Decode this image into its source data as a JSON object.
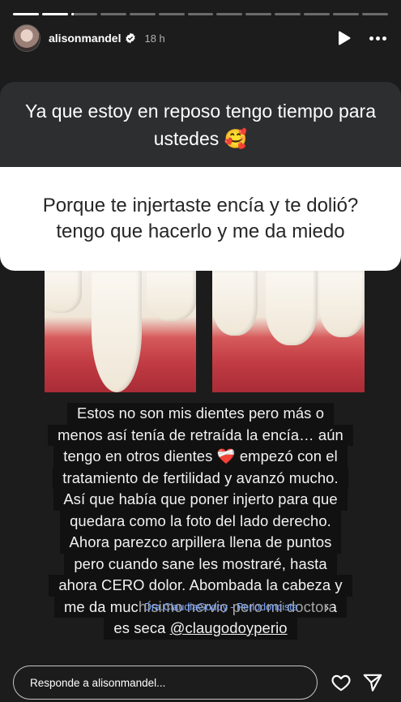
{
  "story": {
    "segments": [
      1,
      1,
      0.1,
      0,
      0,
      0,
      0,
      0,
      0,
      0,
      0,
      0,
      0
    ],
    "username": "alisonmandel",
    "verified": true,
    "time_ago": "18 h"
  },
  "question_box": {
    "prompt": "Ya que estoy en reposo tengo tiempo para ustedes 🥰",
    "question": "Porque te injertaste encía y te dolió? tengo que hacerlo y me da miedo"
  },
  "caption": {
    "lines": [
      "Estos no son mis dientes pero más o",
      "menos así tenía de retraída la encía… aún",
      "tengo en otros dientes ❤️‍🩹 empezó con el",
      "tratamiento de fertilidad y avanzó mucho.",
      "Así que había que poner injerto para que",
      "quedara como la foto del lado derecho.",
      "Ahora parezco arpillera llena de puntos",
      "pero cuando sane les mostraré, hasta",
      "ahora CERO dolor. Abombada la cabeza y",
      "me da muchísimo nervio pero mi doctora"
    ],
    "last_prefix": "es seca ",
    "mention": "@claugodoyperio"
  },
  "link_sticker": {
    "text": "Dra.ClaudiaGodoy - Periodoncista",
    "chevron": "›"
  },
  "footer": {
    "reply_placeholder": "Responde a alisonmandel...",
    "heart_icon": "heart-outline-icon",
    "send_icon": "send-paper-plane-icon"
  }
}
